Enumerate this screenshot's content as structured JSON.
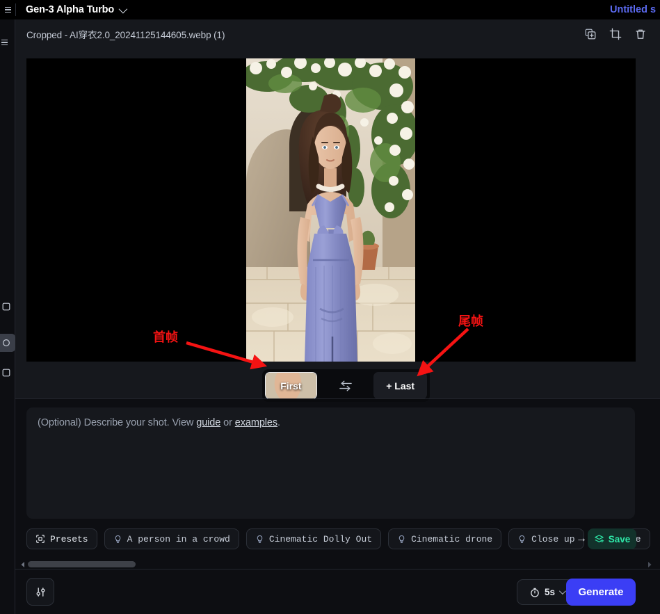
{
  "topbar": {
    "menu_icon": "hamburger-icon",
    "model_name": "Gen-3 Alpha Turbo",
    "model_chevron": "chevron-down-icon",
    "session_title": "Untitled s"
  },
  "sidebar": {
    "items": [
      {
        "name": "assets",
        "icon": "square-icon"
      },
      {
        "name": "selected-tool",
        "icon": "circle-icon",
        "selected": true
      },
      {
        "name": "library",
        "icon": "square-icon"
      }
    ]
  },
  "panel": {
    "title": "Cropped - AI穿衣2.0_20241125144605.webp (1)",
    "actions": [
      {
        "name": "duplicate",
        "icon": "duplicate-plus-icon"
      },
      {
        "name": "crop",
        "icon": "crop-icon"
      },
      {
        "name": "delete",
        "icon": "trash-icon"
      }
    ]
  },
  "frames": {
    "first_label": "First",
    "swap_icon": "swap-arrows-icon",
    "last_label": "+ Last"
  },
  "prompt": {
    "placeholder_prefix": "(Optional) Describe your shot. View ",
    "guide_link": "guide",
    "placeholder_mid": " or ",
    "examples_link": "examples",
    "placeholder_suffix": ".",
    "value": ""
  },
  "presets": {
    "presets_label": "Presets",
    "presets_icon": "frame-target-icon",
    "chips": [
      {
        "label": "A person in a crowd",
        "icon": "lightbulb-icon"
      },
      {
        "label": "Cinematic Dolly Out",
        "icon": "lightbulb-icon"
      },
      {
        "label": "Cinematic drone",
        "icon": "lightbulb-icon"
      },
      {
        "label": "Close up",
        "icon": "lightbulb-icon"
      },
      {
        "label": "Close",
        "icon": "lightbulb-icon"
      }
    ],
    "scroll_right_icon": "arrow-right-icon",
    "save_label": "Save",
    "save_icon": "layers-plus-icon",
    "save_color": "#2ee8a8",
    "save_bg": "#12322b"
  },
  "scrollbar": {
    "left_arrow_icon": "triangle-left-icon",
    "right_arrow_icon": "triangle-right-icon"
  },
  "bottombar": {
    "settings_icon": "sliders-icon",
    "duration_icon": "stopwatch-icon",
    "duration_value": "5s",
    "duration_chevron": "chevron-down-icon",
    "generate_label": "Generate",
    "generate_color": "#3b3ef5"
  },
  "annotations": {
    "first_frame": "首帧",
    "last_frame": "尾帧",
    "color": "#f51313"
  }
}
